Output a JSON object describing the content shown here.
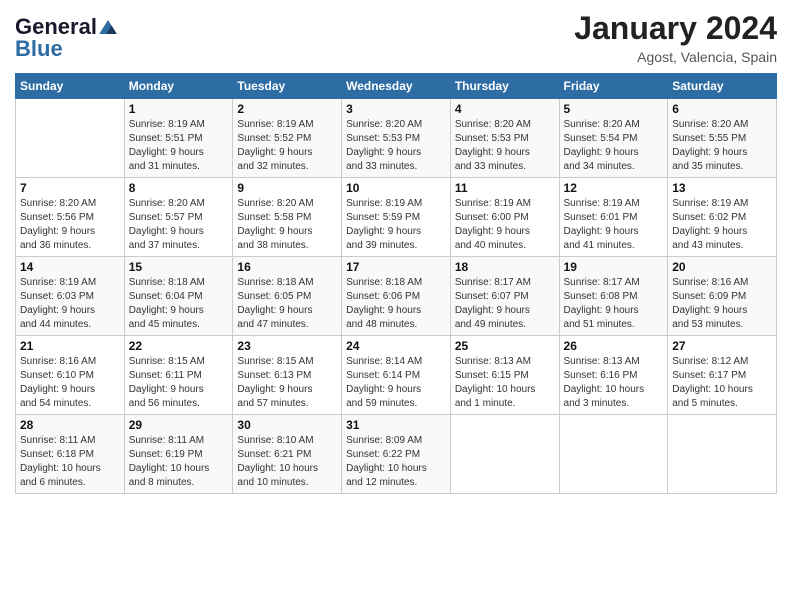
{
  "header": {
    "logo_general": "General",
    "logo_blue": "Blue",
    "month_title": "January 2024",
    "location": "Agost, Valencia, Spain"
  },
  "weekdays": [
    "Sunday",
    "Monday",
    "Tuesday",
    "Wednesday",
    "Thursday",
    "Friday",
    "Saturday"
  ],
  "weeks": [
    [
      {
        "day": "",
        "info": ""
      },
      {
        "day": "1",
        "info": "Sunrise: 8:19 AM\nSunset: 5:51 PM\nDaylight: 9 hours\nand 31 minutes."
      },
      {
        "day": "2",
        "info": "Sunrise: 8:19 AM\nSunset: 5:52 PM\nDaylight: 9 hours\nand 32 minutes."
      },
      {
        "day": "3",
        "info": "Sunrise: 8:20 AM\nSunset: 5:53 PM\nDaylight: 9 hours\nand 33 minutes."
      },
      {
        "day": "4",
        "info": "Sunrise: 8:20 AM\nSunset: 5:53 PM\nDaylight: 9 hours\nand 33 minutes."
      },
      {
        "day": "5",
        "info": "Sunrise: 8:20 AM\nSunset: 5:54 PM\nDaylight: 9 hours\nand 34 minutes."
      },
      {
        "day": "6",
        "info": "Sunrise: 8:20 AM\nSunset: 5:55 PM\nDaylight: 9 hours\nand 35 minutes."
      }
    ],
    [
      {
        "day": "7",
        "info": "Sunrise: 8:20 AM\nSunset: 5:56 PM\nDaylight: 9 hours\nand 36 minutes."
      },
      {
        "day": "8",
        "info": "Sunrise: 8:20 AM\nSunset: 5:57 PM\nDaylight: 9 hours\nand 37 minutes."
      },
      {
        "day": "9",
        "info": "Sunrise: 8:20 AM\nSunset: 5:58 PM\nDaylight: 9 hours\nand 38 minutes."
      },
      {
        "day": "10",
        "info": "Sunrise: 8:19 AM\nSunset: 5:59 PM\nDaylight: 9 hours\nand 39 minutes."
      },
      {
        "day": "11",
        "info": "Sunrise: 8:19 AM\nSunset: 6:00 PM\nDaylight: 9 hours\nand 40 minutes."
      },
      {
        "day": "12",
        "info": "Sunrise: 8:19 AM\nSunset: 6:01 PM\nDaylight: 9 hours\nand 41 minutes."
      },
      {
        "day": "13",
        "info": "Sunrise: 8:19 AM\nSunset: 6:02 PM\nDaylight: 9 hours\nand 43 minutes."
      }
    ],
    [
      {
        "day": "14",
        "info": "Sunrise: 8:19 AM\nSunset: 6:03 PM\nDaylight: 9 hours\nand 44 minutes."
      },
      {
        "day": "15",
        "info": "Sunrise: 8:18 AM\nSunset: 6:04 PM\nDaylight: 9 hours\nand 45 minutes."
      },
      {
        "day": "16",
        "info": "Sunrise: 8:18 AM\nSunset: 6:05 PM\nDaylight: 9 hours\nand 47 minutes."
      },
      {
        "day": "17",
        "info": "Sunrise: 8:18 AM\nSunset: 6:06 PM\nDaylight: 9 hours\nand 48 minutes."
      },
      {
        "day": "18",
        "info": "Sunrise: 8:17 AM\nSunset: 6:07 PM\nDaylight: 9 hours\nand 49 minutes."
      },
      {
        "day": "19",
        "info": "Sunrise: 8:17 AM\nSunset: 6:08 PM\nDaylight: 9 hours\nand 51 minutes."
      },
      {
        "day": "20",
        "info": "Sunrise: 8:16 AM\nSunset: 6:09 PM\nDaylight: 9 hours\nand 53 minutes."
      }
    ],
    [
      {
        "day": "21",
        "info": "Sunrise: 8:16 AM\nSunset: 6:10 PM\nDaylight: 9 hours\nand 54 minutes."
      },
      {
        "day": "22",
        "info": "Sunrise: 8:15 AM\nSunset: 6:11 PM\nDaylight: 9 hours\nand 56 minutes."
      },
      {
        "day": "23",
        "info": "Sunrise: 8:15 AM\nSunset: 6:13 PM\nDaylight: 9 hours\nand 57 minutes."
      },
      {
        "day": "24",
        "info": "Sunrise: 8:14 AM\nSunset: 6:14 PM\nDaylight: 9 hours\nand 59 minutes."
      },
      {
        "day": "25",
        "info": "Sunrise: 8:13 AM\nSunset: 6:15 PM\nDaylight: 10 hours\nand 1 minute."
      },
      {
        "day": "26",
        "info": "Sunrise: 8:13 AM\nSunset: 6:16 PM\nDaylight: 10 hours\nand 3 minutes."
      },
      {
        "day": "27",
        "info": "Sunrise: 8:12 AM\nSunset: 6:17 PM\nDaylight: 10 hours\nand 5 minutes."
      }
    ],
    [
      {
        "day": "28",
        "info": "Sunrise: 8:11 AM\nSunset: 6:18 PM\nDaylight: 10 hours\nand 6 minutes."
      },
      {
        "day": "29",
        "info": "Sunrise: 8:11 AM\nSunset: 6:19 PM\nDaylight: 10 hours\nand 8 minutes."
      },
      {
        "day": "30",
        "info": "Sunrise: 8:10 AM\nSunset: 6:21 PM\nDaylight: 10 hours\nand 10 minutes."
      },
      {
        "day": "31",
        "info": "Sunrise: 8:09 AM\nSunset: 6:22 PM\nDaylight: 10 hours\nand 12 minutes."
      },
      {
        "day": "",
        "info": ""
      },
      {
        "day": "",
        "info": ""
      },
      {
        "day": "",
        "info": ""
      }
    ]
  ]
}
